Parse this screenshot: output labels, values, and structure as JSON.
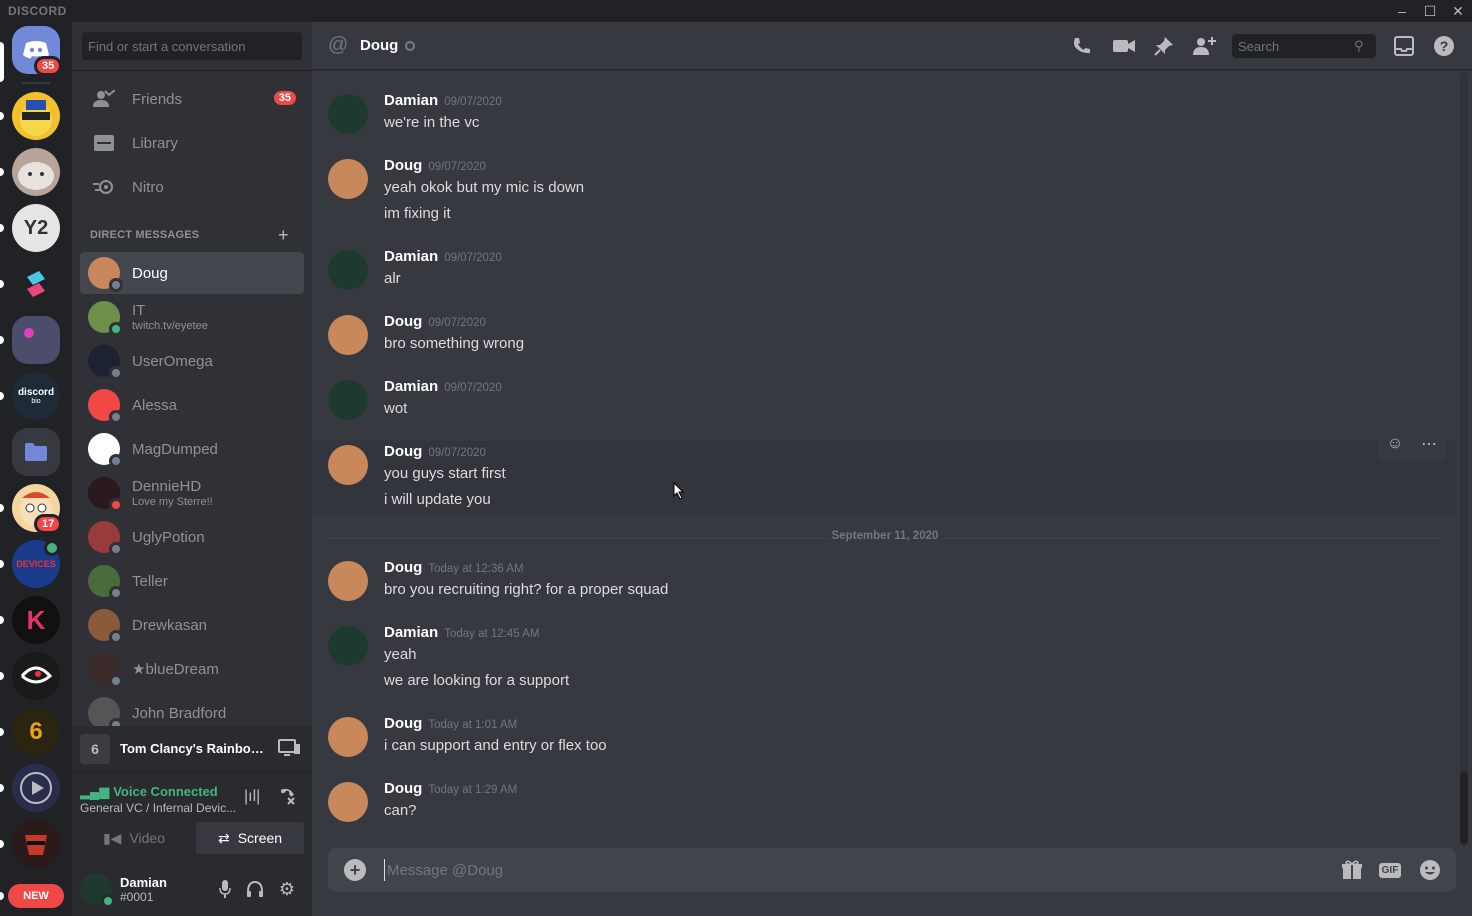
{
  "window": {
    "brand": "DISCORD"
  },
  "rail": {
    "home_badge": "35",
    "server_badge": "17",
    "new_label": "NEW",
    "discord_bio_label": "discord",
    "discord_bio_sub": "bio"
  },
  "sidebar": {
    "search_placeholder": "Find or start a conversation",
    "nav": [
      {
        "label": "Friends",
        "icon": "friends-icon",
        "badge": "35"
      },
      {
        "label": "Library",
        "icon": "library-icon"
      },
      {
        "label": "Nitro",
        "icon": "nitro-icon"
      }
    ],
    "dm_header": "DIRECT MESSAGES",
    "dms": [
      {
        "name": "Doug",
        "status": "offline",
        "color": "#c9885b",
        "active": true
      },
      {
        "name": "IT",
        "sub": "twitch.tv/eyetee",
        "status": "online",
        "color": "#6e8f4a"
      },
      {
        "name": "UserOmega",
        "status": "offline",
        "color": "#1d2233"
      },
      {
        "name": "Alessa",
        "status": "offline",
        "color": "#f04747"
      },
      {
        "name": "MagDumped",
        "status": "offline",
        "color": "#ffffff"
      },
      {
        "name": "DennieHD",
        "sub": "Love my Sterre!!",
        "status": "dnd",
        "color": "#2a1a1e"
      },
      {
        "name": "UglyPotion",
        "status": "offline",
        "color": "#9a3b3b"
      },
      {
        "name": "Teller",
        "status": "offline",
        "color": "#4a6b3b"
      },
      {
        "name": "Drewkasan",
        "status": "offline",
        "color": "#8a5a3a"
      },
      {
        "name": "★blueDream",
        "status": "offline",
        "color": "#3a2a2a"
      },
      {
        "name": "John Bradford",
        "status": "offline",
        "color": "#555555"
      }
    ],
    "activity": {
      "game": "Tom Clancy's Rainbow Six Siege"
    },
    "voice": {
      "title": "Voice Connected",
      "channel": "General VC / Infernal Devic...",
      "video_label": "Video",
      "screen_label": "Screen"
    },
    "user": {
      "name": "Damian",
      "tag": "#0001"
    }
  },
  "chat": {
    "header_name": "Doug",
    "search_placeholder": "Search",
    "composer_placeholder": "Message @Doug",
    "date_divider": "September 11, 2020",
    "messages": [
      {
        "author": "Damian",
        "ts": "09/07/2020",
        "lines": [
          "we're in the vc"
        ]
      },
      {
        "author": "Doug",
        "ts": "09/07/2020",
        "lines": [
          "yeah okok but my mic is down",
          "im fixing it"
        ]
      },
      {
        "author": "Damian",
        "ts": "09/07/2020",
        "lines": [
          "alr"
        ]
      },
      {
        "author": "Doug",
        "ts": "09/07/2020",
        "lines": [
          "bro something wrong"
        ]
      },
      {
        "author": "Damian",
        "ts": "09/07/2020",
        "lines": [
          "wot"
        ]
      },
      {
        "author": "Doug",
        "ts": "09/07/2020",
        "lines": [
          "you guys start first",
          "i will update you"
        ]
      },
      {
        "author": "Doug",
        "ts": "Today at 12:36 AM",
        "lines": [
          "bro you recruiting right? for a proper squad"
        ]
      },
      {
        "author": "Damian",
        "ts": "Today at 12:45 AM",
        "lines": [
          "yeah",
          "we are looking for a support"
        ]
      },
      {
        "author": "Doug",
        "ts": "Today at 1:01 AM",
        "lines": [
          "i can support and entry or flex too"
        ]
      },
      {
        "author": "Doug",
        "ts": "Today at 1:29 AM",
        "lines": [
          "can?"
        ]
      }
    ]
  },
  "colors": {
    "accent": "#7289da",
    "online": "#43b581",
    "dnd": "#f04747",
    "badge": "#f04747"
  }
}
